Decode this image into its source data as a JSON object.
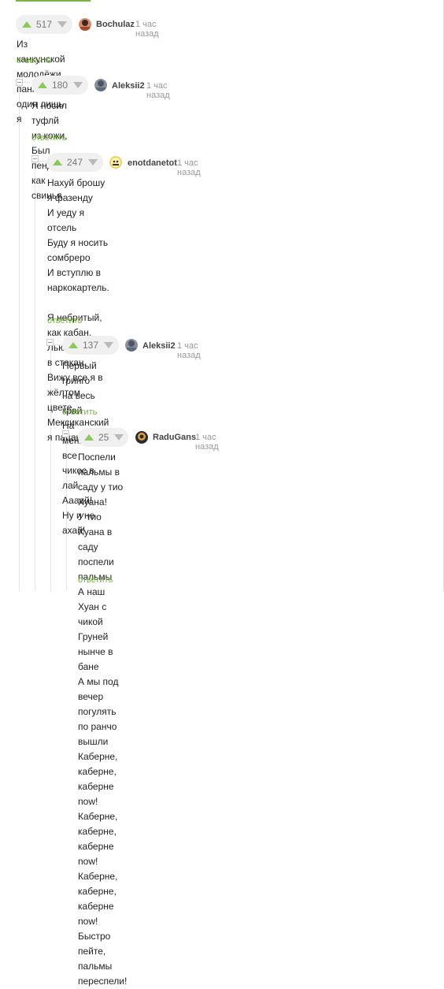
{
  "colors": {
    "accent": "#7bb344",
    "vote_up": "#8ac858",
    "vote_down": "#b9b9b9"
  },
  "comments": [
    {
      "rating": "517",
      "author": "Bochulaz",
      "time": "1 час назад",
      "lines": [
        "Из канкунской молодёжи панковал один лишь я"
      ],
      "reply": "ответить",
      "avatar_icon": "user-avatar-icon"
    },
    {
      "rating": "180",
      "author": "Aleksii2",
      "time": "1 час назад",
      "lines": [
        "Я носил туфлй из кожи,",
        "Был пендехо как свинья"
      ],
      "reply": "ответить",
      "avatar_icon": "user-avatar-icon"
    },
    {
      "rating": "247",
      "author": "enotdanetot",
      "time": "1 час назад",
      "lines": [
        "Нахуй брошу я фазенду",
        "И уеду я отсель",
        "Буду я носить сомбреро",
        "И вступлю в наркокартель.",
        "",
        "Я небритый, как кабан.",
        "Лью текилу я в стакан.",
        "Вижу все я в жёлтом цвете,",
        "Мексиканский я пацан."
      ],
      "reply": "ответить",
      "avatar_icon": "user-avatar-icon"
    },
    {
      "rating": "137",
      "author": "Aleksii2",
      "time": "1 час назад",
      "lines": [
        "Первый гринго на весь край",
        "На меня все чикос в лай",
        "Аааай! Ну и не ахай!"
      ],
      "reply": "ответить",
      "avatar_icon": "user-avatar-icon"
    },
    {
      "rating": "25",
      "author": "RaduGans",
      "time": "1 час назад",
      "lines": [
        "Поспели пальмы в саду у тио Хуана!",
        "У тио Хуана в саду поспели пальмы",
        "А наш Хуан с чикой Груней нынче в бане",
        "А мы под вечер погулять по ранчо вышли",
        "Каберне, каберне, каберне now!",
        "Каберне, каберне, каберне now!",
        "Каберне, каберне, каберне now!",
        "Быстро пейте, пальмы переспели!"
      ],
      "reply": "ответить",
      "avatar_icon": "user-avatar-icon"
    }
  ]
}
